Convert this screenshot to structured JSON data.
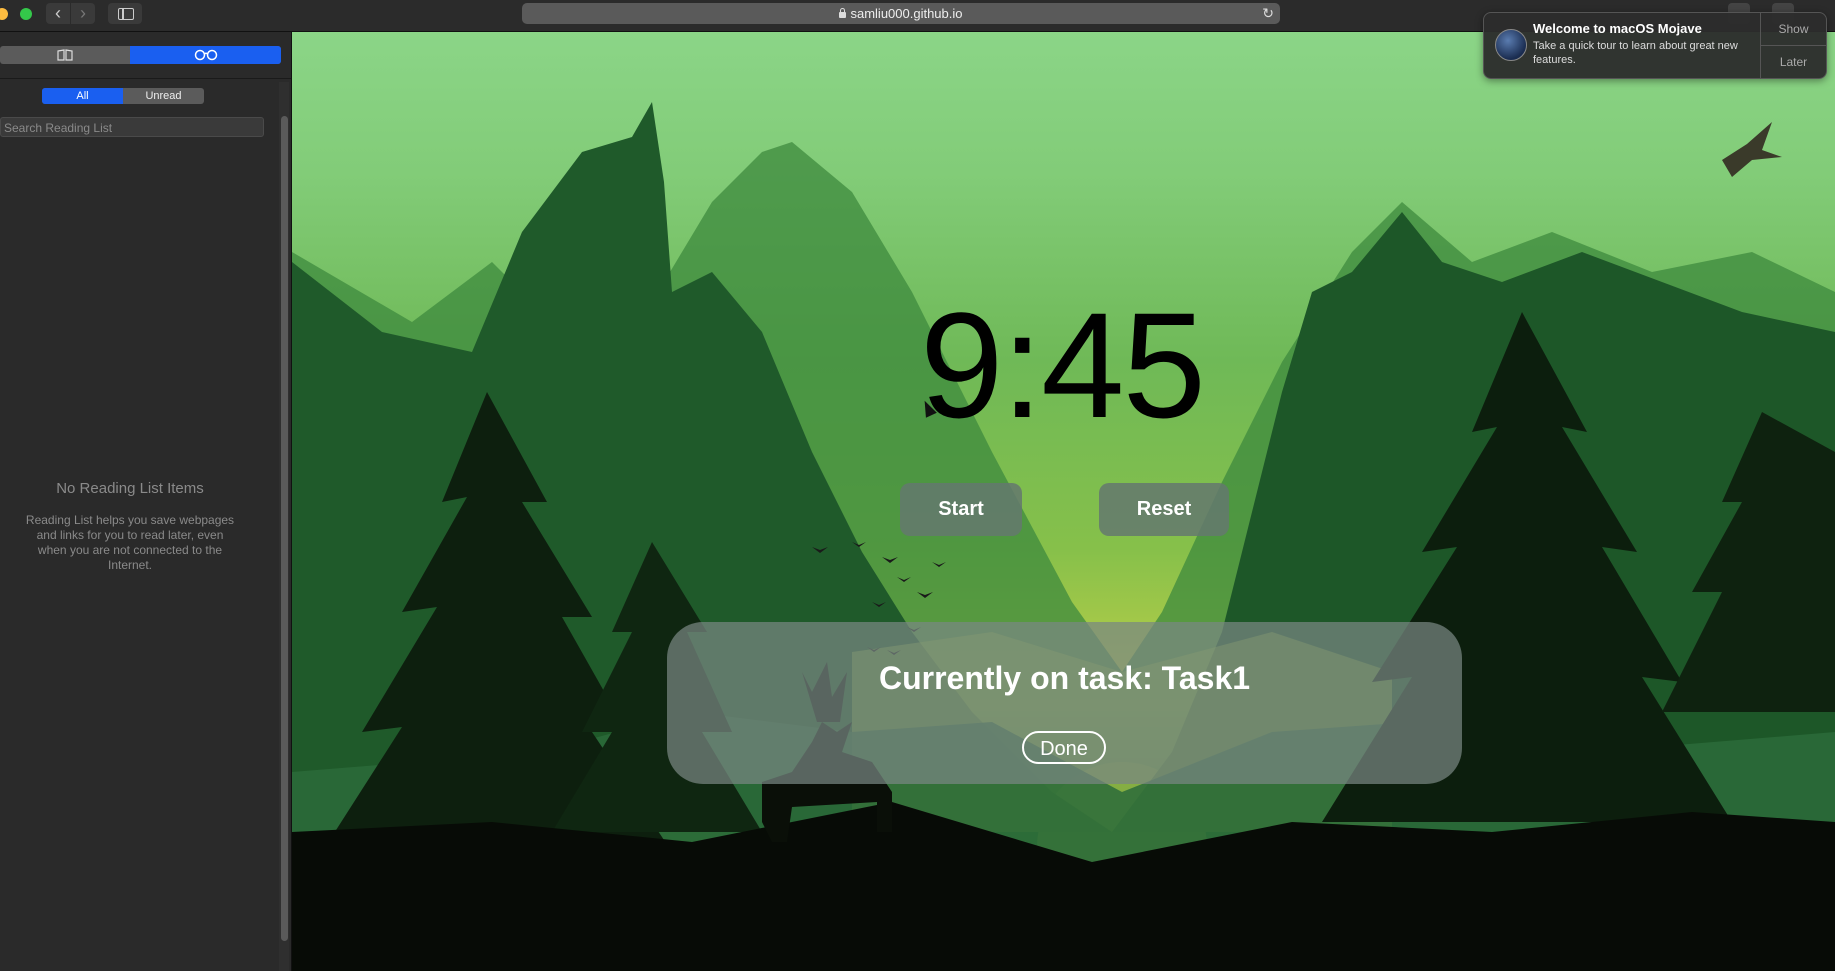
{
  "browser": {
    "url": "samliu000.github.io"
  },
  "sidebar": {
    "filter_all": "All",
    "filter_unread": "Unread",
    "search_placeholder": "Search Reading List",
    "empty_title": "No Reading List Items",
    "empty_desc": "Reading List helps you save webpages and links for you to read later, even when you are not connected to the Internet."
  },
  "page": {
    "timer": "9:45",
    "start_label": "Start",
    "reset_label": "Reset",
    "task_text": "Currently on task: Task1",
    "done_label": "Done"
  },
  "notification": {
    "title": "Welcome to macOS Mojave",
    "body": "Take a quick tour to learn about great new features.",
    "show_label": "Show",
    "later_label": "Later"
  },
  "icons": {
    "back": "chevron-left-icon",
    "forward": "chevron-right-icon",
    "sidebar_toggle": "sidebar-icon",
    "lock": "lock-icon",
    "reload": "reload-icon",
    "bookmarks": "book-icon",
    "reading_list": "glasses-icon"
  },
  "colors": {
    "accent": "#1a5ff0",
    "sky_top": "#8bd587",
    "mountain_dark": "#1f5a2a",
    "sun": "#f6c33a"
  }
}
